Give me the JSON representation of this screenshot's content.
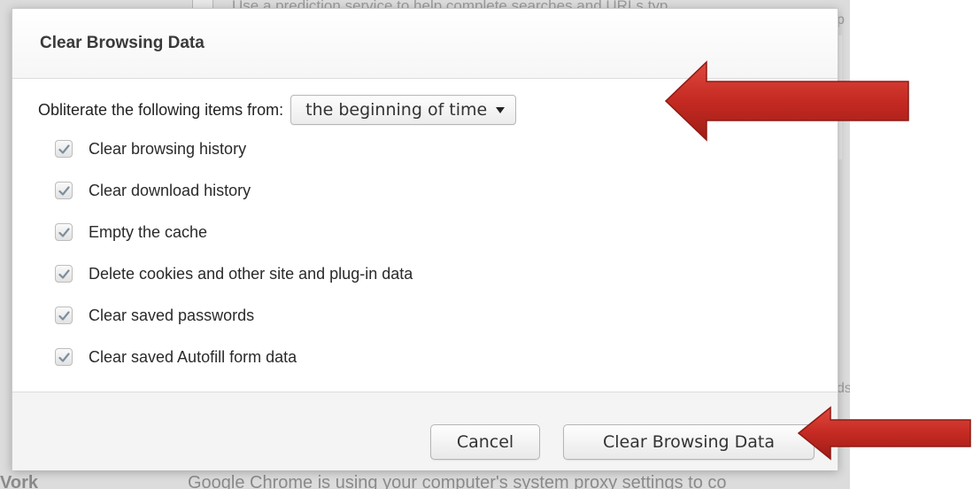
{
  "dialog": {
    "title": "Clear Browsing Data",
    "from_label": "Obliterate the following items from:",
    "time_range": {
      "selected": "the beginning of time"
    },
    "options": [
      {
        "label": "Clear browsing history",
        "checked": true
      },
      {
        "label": "Clear download history",
        "checked": true
      },
      {
        "label": "Empty the cache",
        "checked": true
      },
      {
        "label": "Delete cookies and other site and plug-in data",
        "checked": true
      },
      {
        "label": "Clear saved passwords",
        "checked": true
      },
      {
        "label": "Clear saved Autofill form data",
        "checked": true
      }
    ],
    "buttons": {
      "cancel": "Cancel",
      "confirm": "Clear Browsing Data"
    }
  },
  "background": {
    "top_text": "Use a prediction service to help complete searches and URLs typ",
    "right_char_top": "p",
    "right_char_mid": "ds",
    "bottom_section_head": "Vork",
    "bottom_text": "Google Chrome is using your computer's system proxy settings to co"
  },
  "colors": {
    "arrow": "#c42a22",
    "overlay": "#dcdcdc",
    "dialog_bg": "#ffffff"
  },
  "icons": {
    "checkbox": "checkmark-icon",
    "dropdown": "caret-down-icon",
    "annotation": "red-arrow-icon"
  }
}
